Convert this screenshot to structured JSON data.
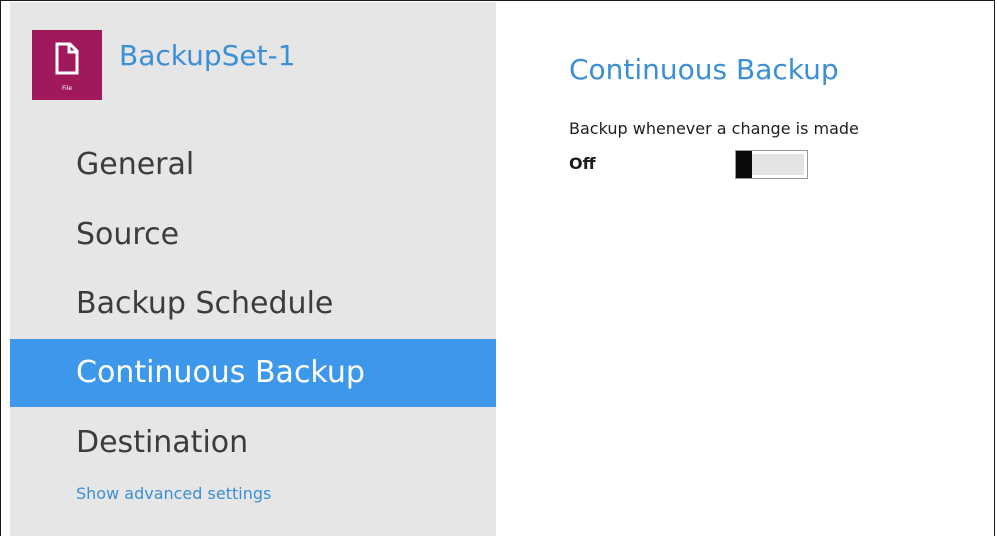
{
  "backup_set": {
    "name": "BackupSet-1",
    "icon": "file-icon",
    "icon_tag": "File",
    "icon_color": "#a0195a"
  },
  "sidebar": {
    "items": [
      {
        "label": "General",
        "active": false
      },
      {
        "label": "Source",
        "active": false
      },
      {
        "label": "Backup Schedule",
        "active": false
      },
      {
        "label": "Continuous Backup",
        "active": true
      },
      {
        "label": "Destination",
        "active": false
      }
    ],
    "advanced_link": "Show advanced settings"
  },
  "main": {
    "title": "Continuous Backup",
    "option_description": "Backup whenever a change is made",
    "toggle": {
      "state_label": "Off",
      "on": false
    }
  },
  "colors": {
    "accent": "#3b8fd6",
    "active_bg": "#3d97ea",
    "sidebar_bg": "#e6e6e6"
  }
}
